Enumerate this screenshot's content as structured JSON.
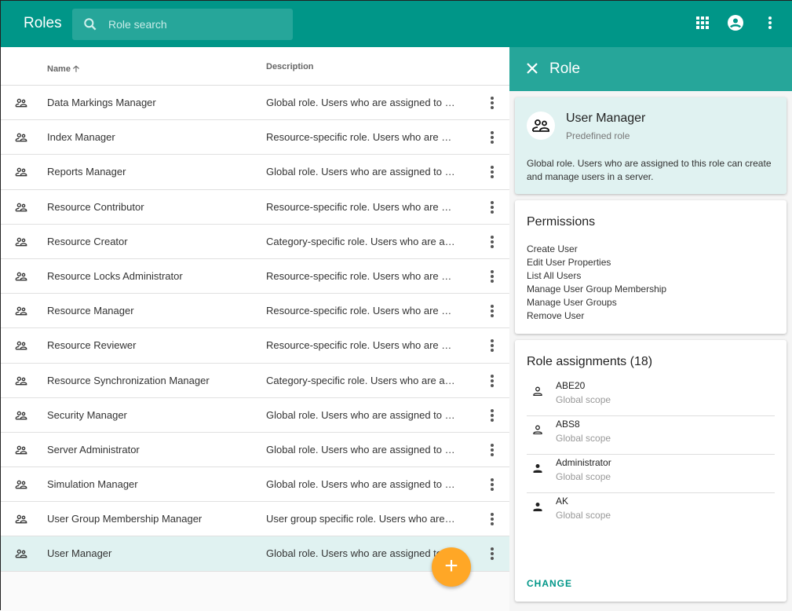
{
  "header": {
    "title": "Roles",
    "search_placeholder": "Role search"
  },
  "table": {
    "columns": {
      "name": "Name",
      "description": "Description"
    },
    "rows": [
      {
        "name": "Data Markings Manager",
        "description": "Global role. Users who are assigned to this role"
      },
      {
        "name": "Index Manager",
        "description": "Resource-specific role. Users who are assigned"
      },
      {
        "name": "Reports Manager",
        "description": "Global role. Users who are assigned to this role"
      },
      {
        "name": "Resource Contributor",
        "description": "Resource-specific role. Users who are assigned"
      },
      {
        "name": "Resource Creator",
        "description": "Category-specific role. Users who are assigned"
      },
      {
        "name": "Resource Locks Administrator",
        "description": "Resource-specific role. Users who are assigned"
      },
      {
        "name": "Resource Manager",
        "description": "Resource-specific role. Users who are assigned"
      },
      {
        "name": "Resource Reviewer",
        "description": "Resource-specific role. Users who are assigned"
      },
      {
        "name": "Resource Synchronization Manager",
        "description": "Category-specific role. Users who are assigned"
      },
      {
        "name": "Security Manager",
        "description": "Global role. Users who are assigned to this role"
      },
      {
        "name": "Server Administrator",
        "description": "Global role. Users who are assigned to this role"
      },
      {
        "name": "Simulation Manager",
        "description": "Global role. Users who are assigned to this role"
      },
      {
        "name": "User Group Membership Manager",
        "description": "User group specific role. Users who are assigned"
      },
      {
        "name": "User Manager",
        "description": "Global role. Users who are assigned to this role"
      }
    ]
  },
  "fab": {
    "label": "+"
  },
  "panel": {
    "title": "Role",
    "role_name": "User Manager",
    "role_type": "Predefined role",
    "role_description": "Global role. Users who are assigned to this role can create and manage users in a server.",
    "permissions_title": "Permissions",
    "permissions": [
      "Create User",
      "Edit User Properties",
      "List All Users",
      "Manage User Group Membership",
      "Manage User Groups",
      "Remove User"
    ],
    "assignments_title": "Role assignments (18)",
    "assignments": [
      {
        "name": "ABE20",
        "scope": "Global scope",
        "icon": "person-outline-icon"
      },
      {
        "name": "ABS8",
        "scope": "Global scope",
        "icon": "person-outline-icon"
      },
      {
        "name": "Administrator",
        "scope": "Global scope",
        "icon": "person-icon"
      },
      {
        "name": "AK",
        "scope": "Global scope",
        "icon": "person-icon"
      }
    ],
    "change_label": "CHANGE"
  },
  "colors": {
    "primary": "#009688",
    "panel_header": "#26a69a",
    "selected": "#e0f2f1",
    "fab": "#ffa726"
  }
}
